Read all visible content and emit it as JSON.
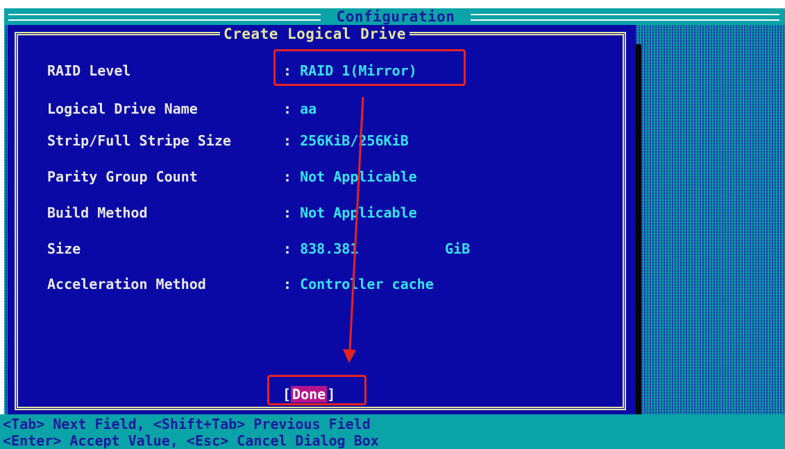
{
  "window": {
    "title": "Configuration"
  },
  "dialog": {
    "title": "Create Logical Drive",
    "fields": [
      {
        "label": "RAID Level",
        "value": "RAID 1(Mirror)"
      },
      {
        "label": "Logical Drive Name",
        "value": "aa"
      },
      {
        "label": "Strip/Full Stripe Size",
        "value": "256KiB/256KiB"
      },
      {
        "label": "Parity Group Count",
        "value": "Not Applicable"
      },
      {
        "label": "Build Method",
        "value": "Not Applicable"
      },
      {
        "label": "Size",
        "value": "838.381",
        "unit": "GiB"
      },
      {
        "label": "Acceleration Method",
        "value": "Controller cache"
      }
    ],
    "colon": ":",
    "done": {
      "open": "[",
      "label": "Done",
      "close": "]"
    }
  },
  "help": {
    "line1": "<Tab> Next Field, <Shift+Tab> Previous Field",
    "line2": "<Enter> Accept Value, <Esc> Cancel Dialog Box"
  },
  "colors": {
    "dialog_bg": "#0a09a6",
    "teal": "#0aa3a8",
    "label_text": "#e9e9e9",
    "value_text": "#35e4f0",
    "highlight": "#b5158c",
    "annotation_red": "#e8231f"
  }
}
